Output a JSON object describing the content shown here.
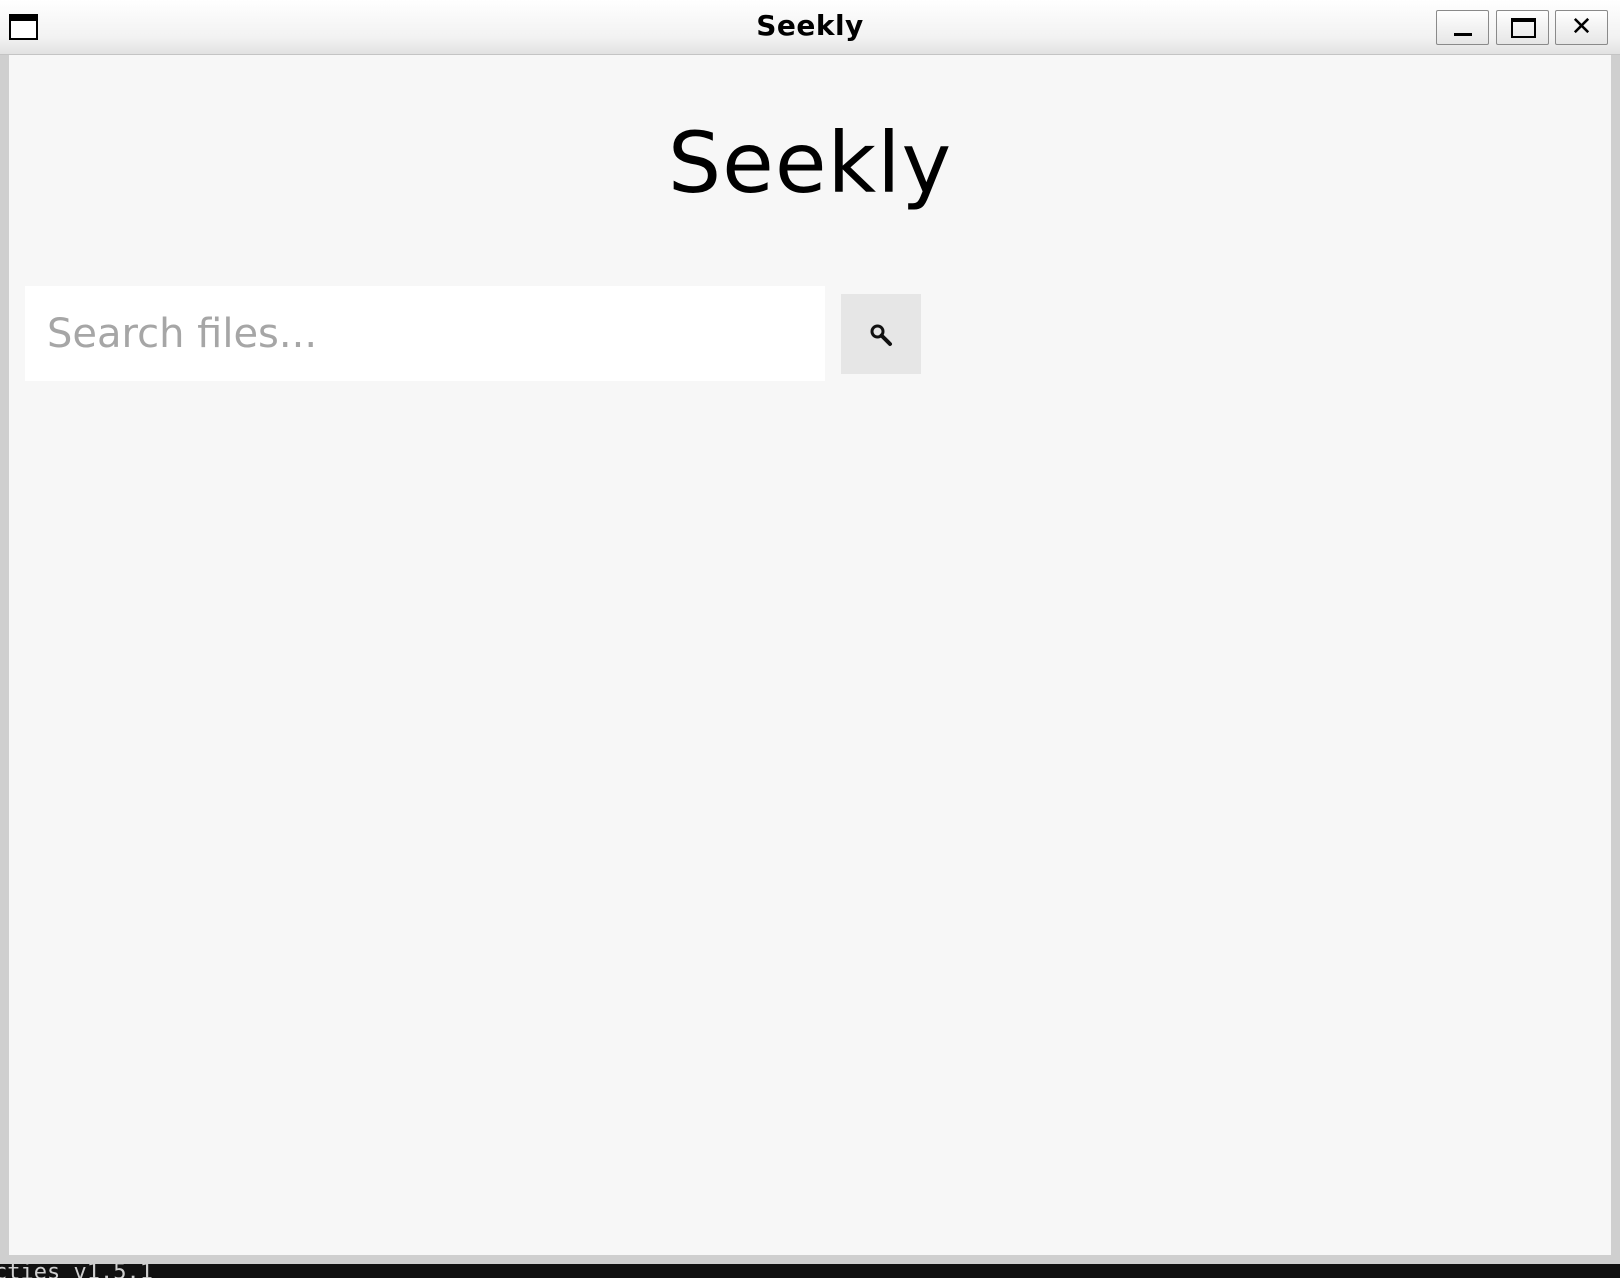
{
  "window": {
    "title": "Seekly"
  },
  "app": {
    "heading": "Seekly",
    "search": {
      "placeholder": "Search files...",
      "value": "",
      "button_icon": "search-icon"
    }
  },
  "background_terminal": {
    "text": "cties v1.5.1"
  }
}
